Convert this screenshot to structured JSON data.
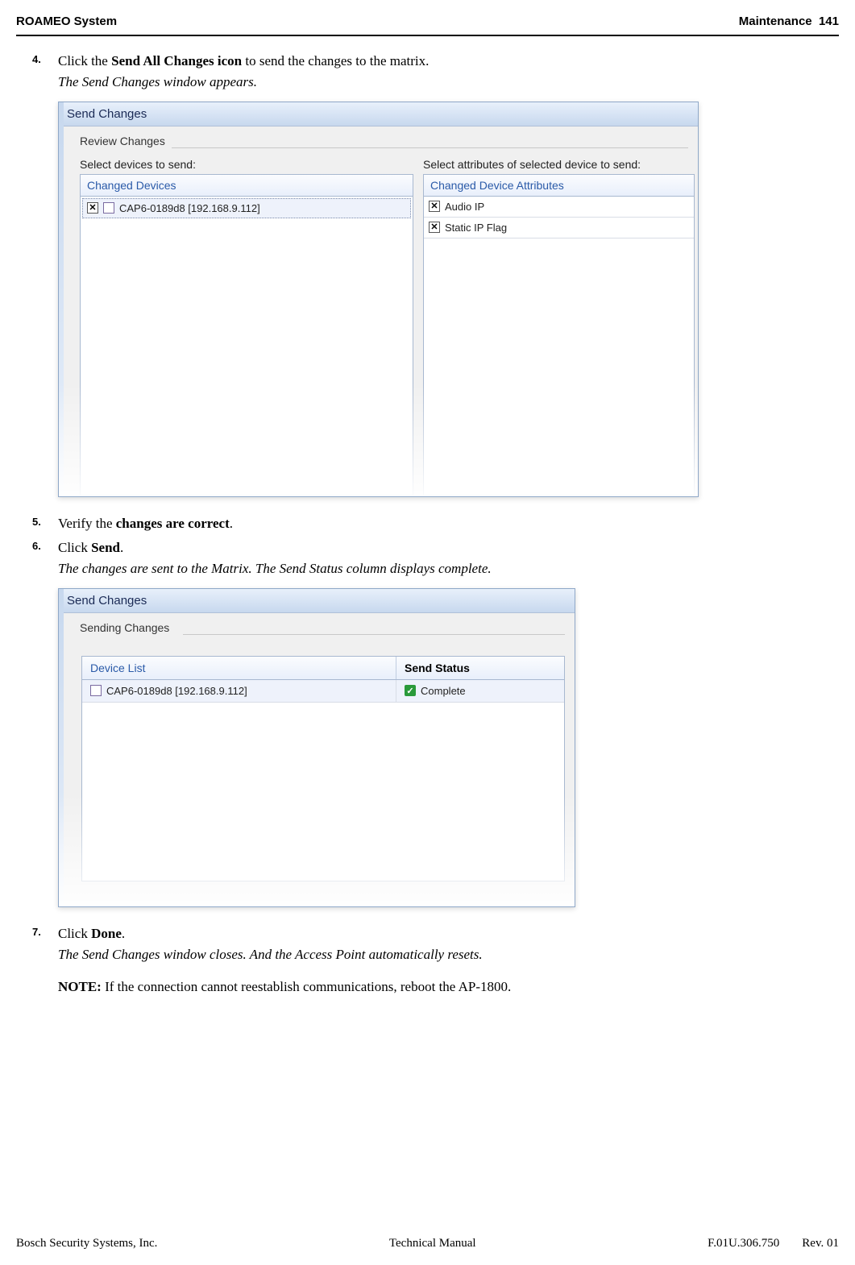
{
  "header": {
    "left": "ROAMEO System",
    "right_section": "Maintenance",
    "right_page": "141"
  },
  "steps": {
    "s4": {
      "num": "4.",
      "text_pre": "Click the ",
      "bold": "Send All Changes icon",
      "text_post": " to send the changes to the matrix.",
      "italic": "The Send Changes window appears."
    },
    "s5": {
      "num": "5.",
      "text_pre": "Verify the ",
      "bold": "changes are correct",
      "text_post": "."
    },
    "s6": {
      "num": "6.",
      "text_pre": "Click ",
      "bold": "Send",
      "text_post": ".",
      "italic": "The changes are sent to the Matrix. The Send Status column displays complete."
    },
    "s7": {
      "num": "7.",
      "text_pre": "Click ",
      "bold": "Done",
      "text_post": ".",
      "italic": "The Send Changes window closes. And the Access Point automatically resets."
    }
  },
  "note": {
    "label": "NOTE:",
    "text": " If the connection cannot reestablish communications, reboot the AP-1800."
  },
  "win1": {
    "title": "Send Changes",
    "group": "Review Changes",
    "left_label": "Select devices to send:",
    "right_label": "Select attributes of selected device to send:",
    "left_header": "Changed Devices",
    "right_header": "Changed Device Attributes",
    "device": "CAP6-0189d8 [192.168.9.112]",
    "attrs": [
      "Audio IP",
      "Static IP Flag"
    ]
  },
  "win2": {
    "title": "Send Changes",
    "group": "Sending Changes",
    "col_device": "Device List",
    "col_status": "Send Status",
    "device": "CAP6-0189d8 [192.168.9.112]",
    "status": "Complete"
  },
  "footer": {
    "left": "Bosch Security Systems, Inc.",
    "center": "Technical Manual",
    "doc": "F.01U.306.750",
    "rev": "Rev. 01"
  }
}
